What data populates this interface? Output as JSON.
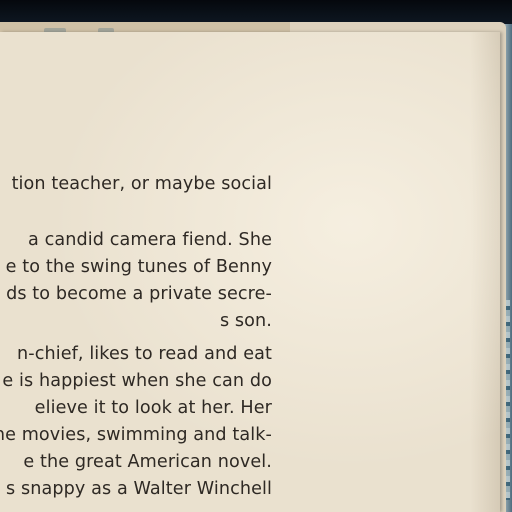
{
  "document": {
    "lines": [
      "tion teacher, or maybe social",
      "a candid camera fiend.  She",
      "e to the swing tunes of Benny",
      "ds to become a private secre-",
      "s son.",
      "n-chief, likes to read and eat",
      "e is happiest when she can do",
      "elieve it to look at her.  Her",
      "he movies, swimming and talk-",
      "e the great American novel.",
      "s snappy as a Walter Winchell"
    ]
  },
  "colors": {
    "paper": "#eae1cf",
    "ink": "#2e2924",
    "background": "#0c1520",
    "cover": "#4d6c7e"
  }
}
